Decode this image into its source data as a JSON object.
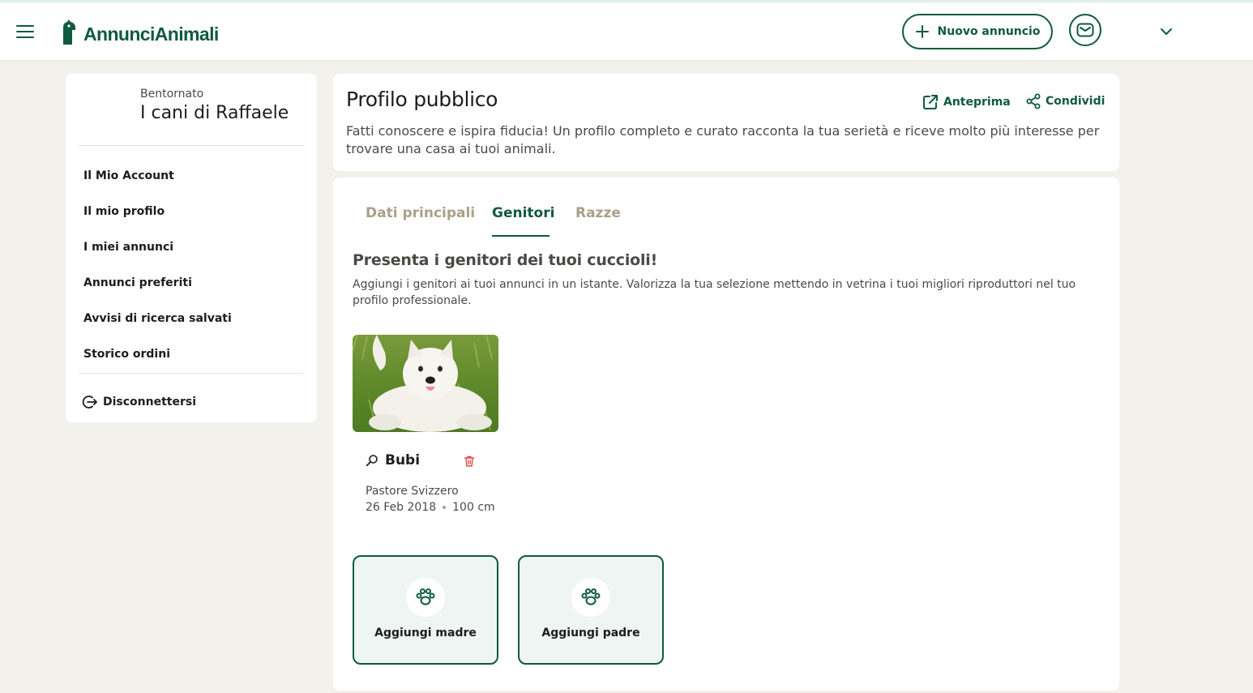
{
  "header": {
    "logo_text": "AnnunciAnimali",
    "new_ad_label": "Nuovo annuncio",
    "menu_icon": "hamburger-icon",
    "mail_icon": "mail-icon",
    "account_dropdown_icon": "chevron-down-icon",
    "accent_color": "#0f5a3e"
  },
  "sidebar": {
    "welcome": "Bentornato",
    "account_name": "I cani di Raffaele",
    "items": [
      {
        "label": "Il Mio Account"
      },
      {
        "label": "Il mio profilo"
      },
      {
        "label": "I miei annunci"
      },
      {
        "label": "Annunci preferiti"
      },
      {
        "label": "Avvisi di ricerca salvati"
      },
      {
        "label": "Storico ordini"
      }
    ],
    "logout_label": "Disconnettersi"
  },
  "profile": {
    "title": "Profilo pubblico",
    "preview_label": "Anteprima",
    "share_label": "Condividi",
    "description": "Fatti conoscere e ispira fiducia! Un profilo completo e curato racconta la tua serietà e riceve molto più interesse per trovare una casa ai tuoi animali."
  },
  "tabs": [
    {
      "label": "Dati principali",
      "active": false
    },
    {
      "label": "Genitori",
      "active": true
    },
    {
      "label": "Razze",
      "active": false
    }
  ],
  "parents": {
    "title": "Presenta i genitori dei tuoi cuccioli!",
    "description": "Aggiungi i genitori ai tuoi annunci in un istante. Valorizza la tua selezione mettendo in vetrina i tuoi migliori riproduttori nel tuo profilo professionale.",
    "dog": {
      "name": "Bubi",
      "breed": "Pastore Svizzero",
      "birth_date": "26 Feb 2018",
      "height": "100 cm"
    },
    "add_mother_label": "Aggiungi madre",
    "add_father_label": "Aggiungi padre"
  }
}
